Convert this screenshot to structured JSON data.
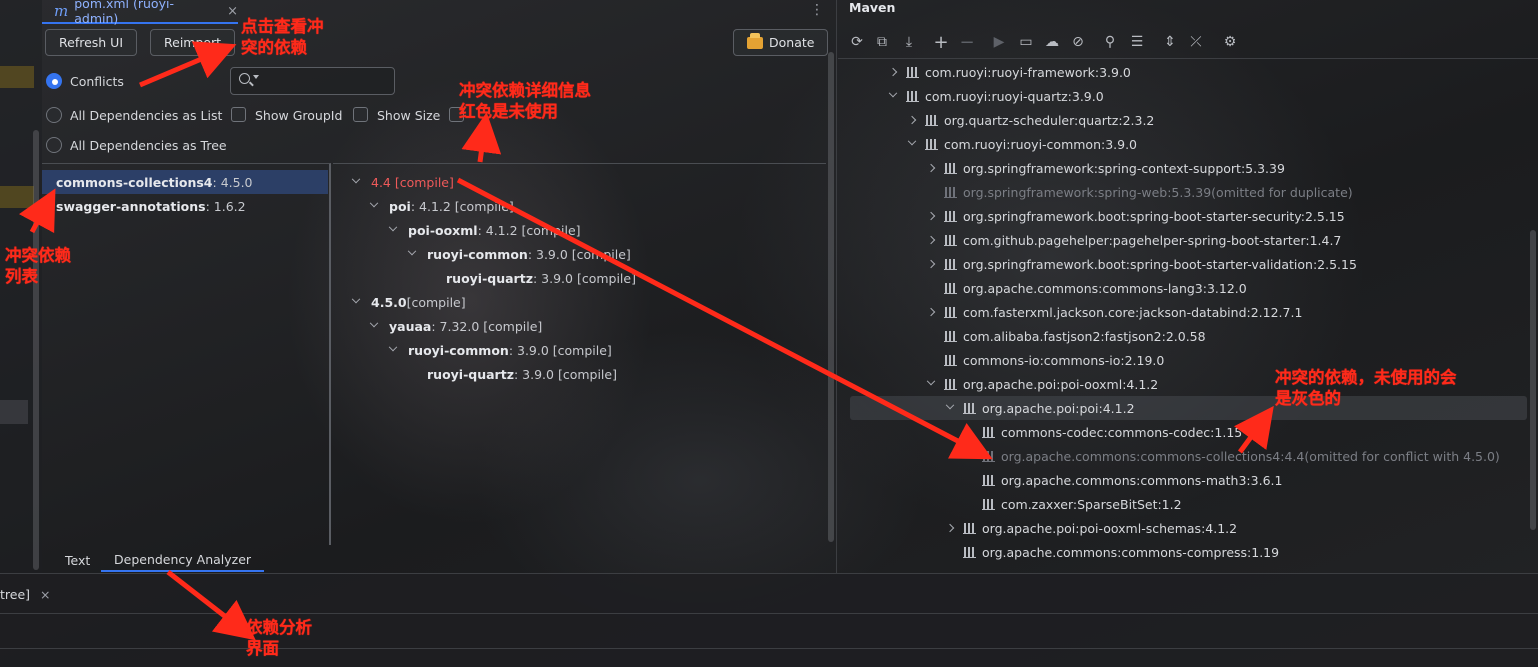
{
  "editor": {
    "tab_icon": "m",
    "tab_title": "pom.xml (ruoyi-admin)",
    "tab_close": "×",
    "more": "⋮"
  },
  "toolbar": {
    "refresh_label": "Refresh UI",
    "reimport_label": "Reimport",
    "donate_label": "Donate"
  },
  "modes": [
    {
      "label": "Conflicts",
      "selected": true
    },
    {
      "label": "All Dependencies as List",
      "selected": false
    },
    {
      "label": "All Dependencies as Tree",
      "selected": false
    }
  ],
  "options": {
    "show_groupid": "Show GroupId",
    "show_size": "Show Size"
  },
  "conflict_list": [
    {
      "name": "commons-collections4",
      "version": " : 4.5.0",
      "selected": true
    },
    {
      "name": "swagger-annotations",
      "version": " : 1.6.2",
      "selected": false
    }
  ],
  "conflict_tree": [
    {
      "name": "",
      "detail": "4.4 [compile]",
      "red": true
    },
    {
      "name": "poi",
      "detail": " : 4.1.2 [compile]"
    },
    {
      "name": "poi-ooxml",
      "detail": " : 4.1.2 [compile]"
    },
    {
      "name": "ruoyi-common",
      "detail": " : 3.9.0 [compile]"
    },
    {
      "name": "ruoyi-quartz",
      "detail": " : 3.9.0 [compile]"
    },
    {
      "name": "4.5.0",
      "detail": " [compile]"
    },
    {
      "name": "yauaa",
      "detail": " : 7.32.0 [compile]"
    },
    {
      "name": "ruoyi-common",
      "detail": " : 3.9.0 [compile]"
    },
    {
      "name": "ruoyi-quartz",
      "detail": " : 3.9.0 [compile]"
    }
  ],
  "bottom_tabs": {
    "text": "Text",
    "analyzer": "Dependency Analyzer",
    "tree_tab": "tree]",
    "tree_close": "×"
  },
  "maven": {
    "title": "Maven",
    "toolbar_icons": [
      "reload-icon",
      "generate-sources-icon",
      "download-icon",
      "add-icon",
      "remove-icon",
      "run-icon",
      "execute-goal-icon",
      "toggle-offline-icon",
      "skip-tests-icon",
      "show-dependencies-icon",
      "show-ignored-icon",
      "expand-all-icon",
      "collapse-all-icon",
      "settings-icon"
    ],
    "tree": [
      {
        "label": "com.ruoyi:ruoyi-framework:3.9.0",
        "suffix": ""
      },
      {
        "label": "com.ruoyi:ruoyi-quartz:3.9.0",
        "suffix": ""
      },
      {
        "label": "org.quartz-scheduler:quartz:2.3.2",
        "suffix": ""
      },
      {
        "label": "com.ruoyi:ruoyi-common:3.9.0",
        "suffix": ""
      },
      {
        "label": "org.springframework:spring-context-support:5.3.39",
        "suffix": ""
      },
      {
        "label": "org.springframework:spring-web:5.3.39",
        "suffix": " (omitted for duplicate)"
      },
      {
        "label": "org.springframework.boot:spring-boot-starter-security:2.5.15",
        "suffix": ""
      },
      {
        "label": "com.github.pagehelper:pagehelper-spring-boot-starter:1.4.7",
        "suffix": ""
      },
      {
        "label": "org.springframework.boot:spring-boot-starter-validation:2.5.15",
        "suffix": ""
      },
      {
        "label": "org.apache.commons:commons-lang3:3.12.0",
        "suffix": ""
      },
      {
        "label": "com.fasterxml.jackson.core:jackson-databind:2.12.7.1",
        "suffix": ""
      },
      {
        "label": "com.alibaba.fastjson2:fastjson2:2.0.58",
        "suffix": ""
      },
      {
        "label": "commons-io:commons-io:2.19.0",
        "suffix": ""
      },
      {
        "label": "org.apache.poi:poi-ooxml:4.1.2",
        "suffix": ""
      },
      {
        "label": "org.apache.poi:poi:4.1.2",
        "suffix": ""
      },
      {
        "label": "commons-codec:commons-codec:1.15",
        "suffix": ""
      },
      {
        "label": "org.apache.commons:commons-collections4:4.4",
        "suffix": " (omitted for conflict with 4.5.0)"
      },
      {
        "label": "org.apache.commons:commons-math3:3.6.1",
        "suffix": ""
      },
      {
        "label": "com.zaxxer:SparseBitSet:1.2",
        "suffix": ""
      },
      {
        "label": "org.apache.poi:poi-ooxml-schemas:4.1.2",
        "suffix": ""
      },
      {
        "label": "org.apache.commons:commons-compress:1.19",
        "suffix": ""
      }
    ]
  },
  "annotations": {
    "click_view_conflict": [
      "点击查看冲",
      "突的依赖"
    ],
    "conflict_detail": [
      "冲突依赖详细信息",
      "红色是未使用"
    ],
    "conflict_list": [
      "冲突依赖",
      "列表"
    ],
    "grey_unused": [
      "冲突的依赖，未使用的会",
      "是灰色的"
    ],
    "analyzer_ui": [
      "依赖分析",
      "界面"
    ]
  },
  "colors": {
    "accent": "#3574f0",
    "conflict_red": "#ef5a5a",
    "annotation_red": "#ff2a1a",
    "omitted_grey": "#7b7e85"
  }
}
